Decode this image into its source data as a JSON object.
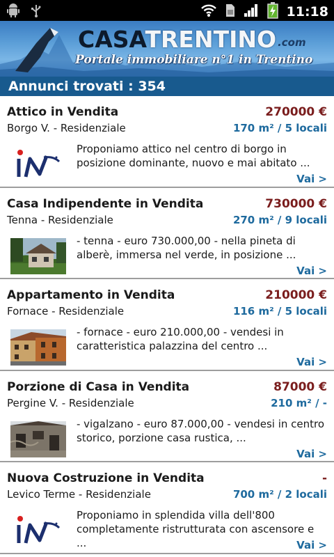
{
  "status_bar": {
    "time": "11:18",
    "icons": [
      "android-debug-icon",
      "usb-icon",
      "wifi-icon",
      "sim-icon",
      "signal-icon",
      "battery-charging-icon"
    ]
  },
  "header": {
    "brand_casa": "CASA",
    "brand_trentino": "TRENTINO",
    "brand_suffix": ".com",
    "tagline": "Portale immobiliare n°1 in Trentino"
  },
  "results": {
    "label": "Annunci trovati : 354"
  },
  "listings": [
    {
      "title": "Attico in Vendita",
      "price": "270000 €",
      "location": "Borgo V. - Residenziale",
      "size": "170 m² / 5 locali",
      "description": "Proponiamo attico nel centro di borgo in posizione dominante, nuovo e mai abitato ...",
      "thumb": "agency-logo",
      "link": "Vai >"
    },
    {
      "title": "Casa Indipendente in Vendita",
      "price": "730000 €",
      "location": "Tenna - Residenziale",
      "size": "270 m² / 9 locali",
      "description": "- tenna - euro 730.000,00 - nella pineta di alberè, immersa nel verde, in posizione ...",
      "thumb": "house-photo",
      "link": "Vai >"
    },
    {
      "title": "Appartamento in Vendita",
      "price": "210000 €",
      "location": "Fornace - Residenziale",
      "size": "116 m² / 5 locali",
      "description": "- fornace - euro 210.000,00 - vendesi in caratteristica palazzina del centro ...",
      "thumb": "building-photo",
      "link": "Vai >"
    },
    {
      "title": "Porzione di Casa in Vendita",
      "price": "87000 €",
      "location": "Pergine V. - Residenziale",
      "size": "210 m² / -",
      "description": "- vigalzano - euro 87.000,00 - vendesi in centro storico, porzione casa rustica, ...",
      "thumb": "rustic-photo",
      "link": "Vai >"
    },
    {
      "title": "Nuova Costruzione in Vendita",
      "price": "-",
      "location": "Levico Terme - Residenziale",
      "size": "700 m² / 2 locali",
      "description": "Proponiamo in splendida villa dell'800 completamente ristrutturata con ascensore e ...",
      "thumb": "agency-logo",
      "link": "Vai >"
    }
  ]
}
